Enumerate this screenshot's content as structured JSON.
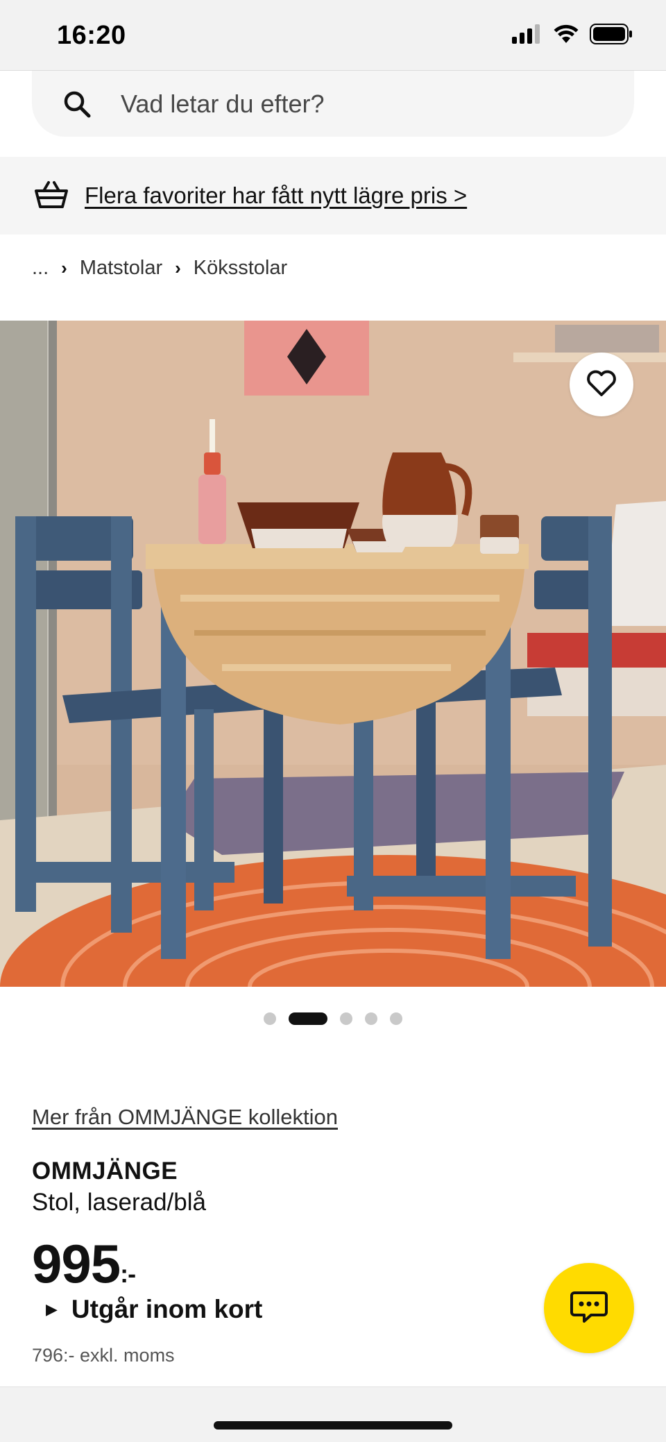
{
  "status_bar": {
    "time": "16:20",
    "icons": [
      "cellular-signal-icon",
      "wifi-icon",
      "battery-icon"
    ]
  },
  "search": {
    "placeholder": "Vad letar du efter?",
    "icon": "search-icon"
  },
  "promo": {
    "icon": "basket-icon",
    "text": "Flera favoriter har fått nytt lägre pris >"
  },
  "breadcrumb": {
    "items": [
      "...",
      "Matstolar",
      "Köksstolar"
    ],
    "separator": "›"
  },
  "gallery": {
    "image_count": 5,
    "active_index": 1,
    "favorite_icon": "heart-icon"
  },
  "product": {
    "collection_link": "Mer från OMMJÄNGE kollektion",
    "name": "OMMJÄNGE",
    "description": "Stol, laserad/blå",
    "price": "995",
    "price_suffix": ":-",
    "stock_status": "Utgår inom kort",
    "price_excl_vat": "796:- exkl. moms"
  },
  "chat": {
    "icon": "chat-bubble-icon"
  },
  "colors": {
    "accent_yellow": "#ffdb00",
    "text": "#111111",
    "background_gray": "#f5f5f5"
  }
}
